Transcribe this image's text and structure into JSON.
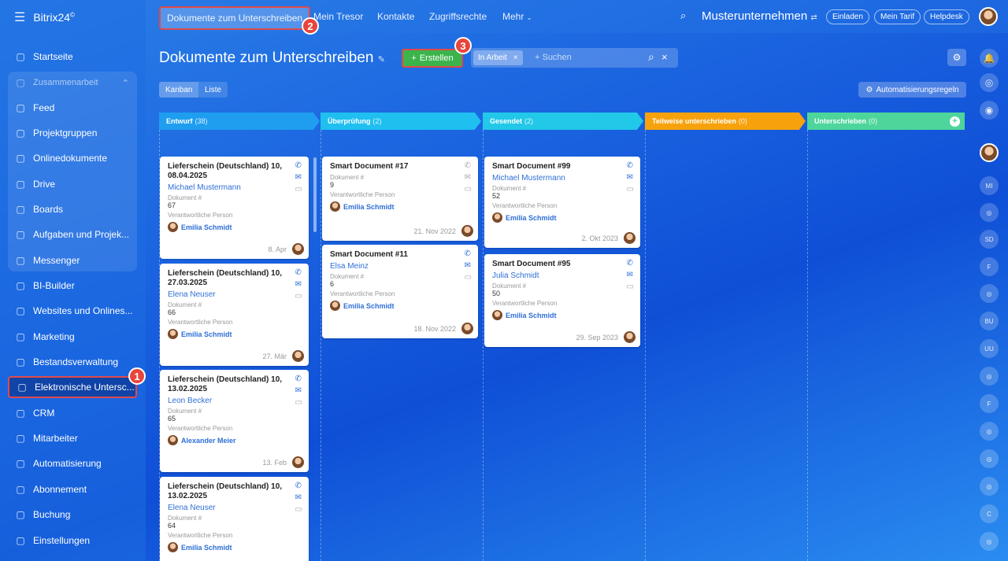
{
  "app": {
    "logo": "Bitrix24",
    "logo_mark": "©"
  },
  "sidebar": {
    "items": [
      {
        "label": "Startseite",
        "icon": "home-icon"
      },
      {
        "label": "Zusammenarbeit",
        "icon": "collab-icon"
      },
      {
        "label": "Feed",
        "icon": "feed-icon"
      },
      {
        "label": "Projektgruppen",
        "icon": "groups-icon"
      },
      {
        "label": "Onlinedokumente",
        "icon": "document-icon"
      },
      {
        "label": "Drive",
        "icon": "drive-icon"
      },
      {
        "label": "Boards",
        "icon": "boards-icon"
      },
      {
        "label": "Aufgaben und Projek...",
        "icon": "tasks-icon"
      },
      {
        "label": "Messenger",
        "icon": "messenger-icon"
      },
      {
        "label": "BI-Builder",
        "icon": "chart-icon"
      },
      {
        "label": "Websites und Onlines...",
        "icon": "cart-icon"
      },
      {
        "label": "Marketing",
        "icon": "target-icon"
      },
      {
        "label": "Bestandsverwaltung",
        "icon": "inventory-icon"
      },
      {
        "label": "Elektronische Untersc...",
        "icon": "signature-icon"
      },
      {
        "label": "CRM",
        "icon": "crm-icon"
      },
      {
        "label": "Mitarbeiter",
        "icon": "employees-icon"
      },
      {
        "label": "Automatisierung",
        "icon": "automation-icon"
      },
      {
        "label": "Abonnement",
        "icon": "subscription-icon"
      },
      {
        "label": "Buchung",
        "icon": "calendar-icon"
      },
      {
        "label": "Einstellungen",
        "icon": "gear-icon"
      }
    ]
  },
  "top": {
    "tabs": [
      "Dokumente zum Unterschreiben",
      "Mein Tresor",
      "Kontakte",
      "Zugriffsrechte",
      "Mehr"
    ],
    "company": "Musterunternehmen",
    "buttons": [
      "Einladen",
      "Mein Tarif",
      "Helpdesk"
    ]
  },
  "page": {
    "title": "Dokumente zum Unterschreiben",
    "create_label": "Erstellen",
    "filter_chip": "In Arbeit",
    "search_placeholder": "+ Suchen",
    "view_kanban": "Kanban",
    "view_list": "Liste",
    "automation_label": "Automatisierungsregeln"
  },
  "badges": [
    "1",
    "2",
    "3"
  ],
  "columns": [
    {
      "name": "Entwurf",
      "count": "(38)",
      "color": "#1f9ef0"
    },
    {
      "name": "Überprüfung",
      "count": "(2)",
      "color": "#1fbff0"
    },
    {
      "name": "Gesendet",
      "count": "(2)",
      "color": "#22c8e8"
    },
    {
      "name": "Teilweise unterschrieben",
      "count": "(0)",
      "color": "#f7a20c"
    },
    {
      "name": "Unterschrieben",
      "count": "(0)",
      "color": "#4ed59b"
    }
  ],
  "cards": {
    "c0": [
      {
        "title": "Lieferschein (Deutschland) 10, 08.04.2025",
        "client": "Michael Mustermann",
        "doc_label": "Dokument #",
        "doc": "67",
        "resp_label": "Verantwortliche Person",
        "resp": "Emilia Schmidt",
        "date": "8. Apr"
      },
      {
        "title": "Lieferschein (Deutschland) 10, 27.03.2025",
        "client": "Elena Neuser",
        "doc_label": "Dokument #",
        "doc": "66",
        "resp_label": "Verantwortliche Person",
        "resp": "Emilia Schmidt",
        "date": "27. Mär"
      },
      {
        "title": "Lieferschein (Deutschland) 10, 13.02.2025",
        "client": "Leon Becker",
        "doc_label": "Dokument #",
        "doc": "65",
        "resp_label": "Verantwortliche Person",
        "resp": "Alexander Meier",
        "date": "13. Feb"
      },
      {
        "title": "Lieferschein (Deutschland) 10, 13.02.2025",
        "client": "Elena Neuser",
        "doc_label": "Dokument #",
        "doc": "64",
        "resp_label": "Verantwortliche Person",
        "resp": "Emilia Schmidt",
        "date": ""
      }
    ],
    "c1": [
      {
        "title": "Smart Document #17",
        "client": "",
        "doc_label": "Dokument #",
        "doc": "9",
        "resp_label": "Verantwortliche Person",
        "resp": "Emilia Schmidt",
        "date": "21. Nov 2022"
      },
      {
        "title": "Smart Document #11",
        "client": "Elsa Meinz",
        "doc_label": "Dokument #",
        "doc": "6",
        "resp_label": "Verantwortliche Person",
        "resp": "Emilia Schmidt",
        "date": "18. Nov 2022"
      }
    ],
    "c2": [
      {
        "title": "Smart Document #99",
        "client": "Michael Mustermann",
        "doc_label": "Dokument #",
        "doc": "52",
        "resp_label": "Verantwortliche Person",
        "resp": "Emilia Schmidt",
        "date": "2. Okt 2023"
      },
      {
        "title": "Smart Document #95",
        "client": "Julia Schmidt",
        "doc_label": "Dokument #",
        "doc": "50",
        "resp_label": "Verantwortliche Person",
        "resp": "Emilia Schmidt",
        "date": "29. Sep 2023"
      }
    ]
  },
  "right_panel": [
    "MI",
    "SD",
    "F",
    "BU",
    "UU",
    "F",
    "C"
  ]
}
